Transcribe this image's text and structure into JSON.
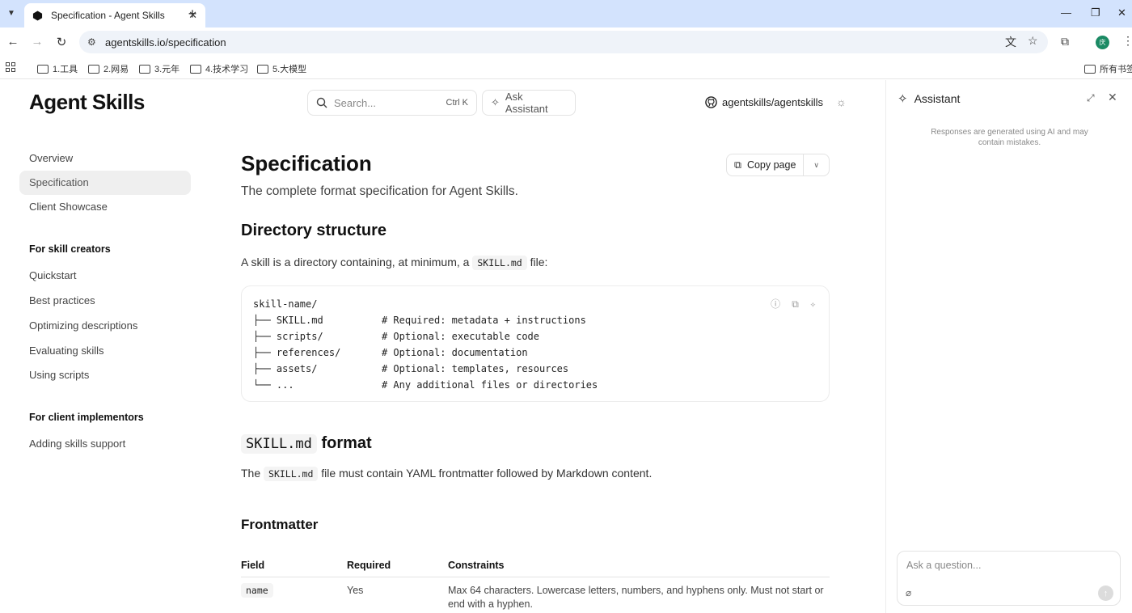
{
  "browser": {
    "tab_title": "Specification - Agent Skills",
    "url": "agentskills.io/specification",
    "bookmarks": [
      "1.工具",
      "2.网易",
      "3.元年",
      "4.技术学习",
      "5.大模型"
    ],
    "all_bookmarks": "所有书签",
    "profile_initial": "庆"
  },
  "header": {
    "logo": "Agent Skills",
    "search_placeholder": "Search...",
    "search_shortcut": "Ctrl K",
    "ask_label": "Ask Assistant",
    "repo": "agentskills/agentskills"
  },
  "sidebar": {
    "items": [
      "Overview",
      "Specification",
      "Client Showcase"
    ],
    "section1_title": "For skill creators",
    "section1_items": [
      "Quickstart",
      "Best practices",
      "Optimizing descriptions",
      "Evaluating skills",
      "Using scripts"
    ],
    "section2_title": "For client implementors",
    "section2_items": [
      "Adding skills support"
    ]
  },
  "content": {
    "title": "Specification",
    "copy_label": "Copy page",
    "subtitle": "The complete format specification for Agent Skills.",
    "dir_heading": "Directory structure",
    "dir_para_before": "A skill is a directory containing, at minimum, a",
    "dir_para_code": "SKILL.md",
    "dir_para_after": "file:",
    "code_lines": [
      "skill-name/",
      "├── SKILL.md          # Required: metadata + instructions",
      "├── scripts/          # Optional: executable code",
      "├── references/       # Optional: documentation",
      "├── assets/           # Optional: templates, resources",
      "└── ...               # Any additional files or directories"
    ],
    "format_heading_code": "SKILL.md",
    "format_heading_text": "format",
    "format_para_before": "The",
    "format_para_code": "SKILL.md",
    "format_para_after": "file must contain YAML frontmatter followed by Markdown content.",
    "frontmatter_heading": "Frontmatter",
    "table_headers": [
      "Field",
      "Required",
      "Constraints"
    ],
    "table_rows": [
      {
        "field": "name",
        "required": "Yes",
        "constraints": "Max 64 characters. Lowercase letters, numbers, and hyphens only. Must not start or end with a hyphen."
      }
    ]
  },
  "assistant": {
    "title": "Assistant",
    "note": "Responses are generated using AI and may contain mistakes.",
    "input_placeholder": "Ask a question..."
  }
}
